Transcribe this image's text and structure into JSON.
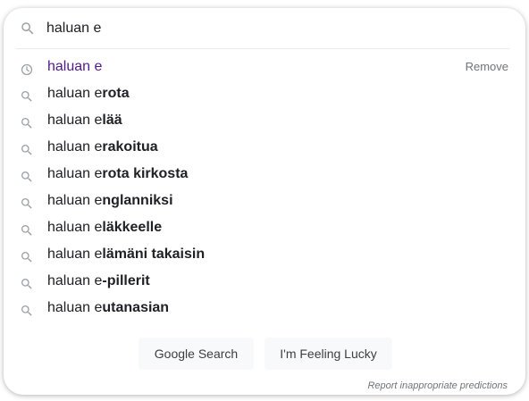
{
  "search": {
    "value": "haluan e",
    "icon": "search-icon"
  },
  "suggestions": [
    {
      "prefix": "haluan e",
      "bold": "",
      "type": "history",
      "icon": "history-icon"
    },
    {
      "prefix": "haluan e",
      "bold": "rota",
      "type": "search",
      "icon": "search-icon"
    },
    {
      "prefix": "haluan e",
      "bold": "lää",
      "type": "search",
      "icon": "search-icon"
    },
    {
      "prefix": "haluan e",
      "bold": "rakoitua",
      "type": "search",
      "icon": "search-icon"
    },
    {
      "prefix": "haluan e",
      "bold": "rota kirkosta",
      "type": "search",
      "icon": "search-icon"
    },
    {
      "prefix": "haluan e",
      "bold": "nglanniksi",
      "type": "search",
      "icon": "search-icon"
    },
    {
      "prefix": "haluan e",
      "bold": "läkkeelle",
      "type": "search",
      "icon": "search-icon"
    },
    {
      "prefix": "haluan e",
      "bold": "lämäni takaisin",
      "type": "search",
      "icon": "search-icon"
    },
    {
      "prefix": "haluan e",
      "bold": "-pillerit",
      "type": "search",
      "icon": "search-icon"
    },
    {
      "prefix": "haluan e",
      "bold": "utanasian",
      "type": "search",
      "icon": "search-icon"
    }
  ],
  "remove_label": "Remove",
  "buttons": {
    "search_label": "Google Search",
    "lucky_label": "I'm Feeling Lucky"
  },
  "report_label": "Report inappropriate predictions",
  "colors": {
    "history_text": "#52188c",
    "text": "#202124",
    "muted": "#70757a",
    "button_bg": "#f8f9fa",
    "icon": "#9aa0a6"
  }
}
